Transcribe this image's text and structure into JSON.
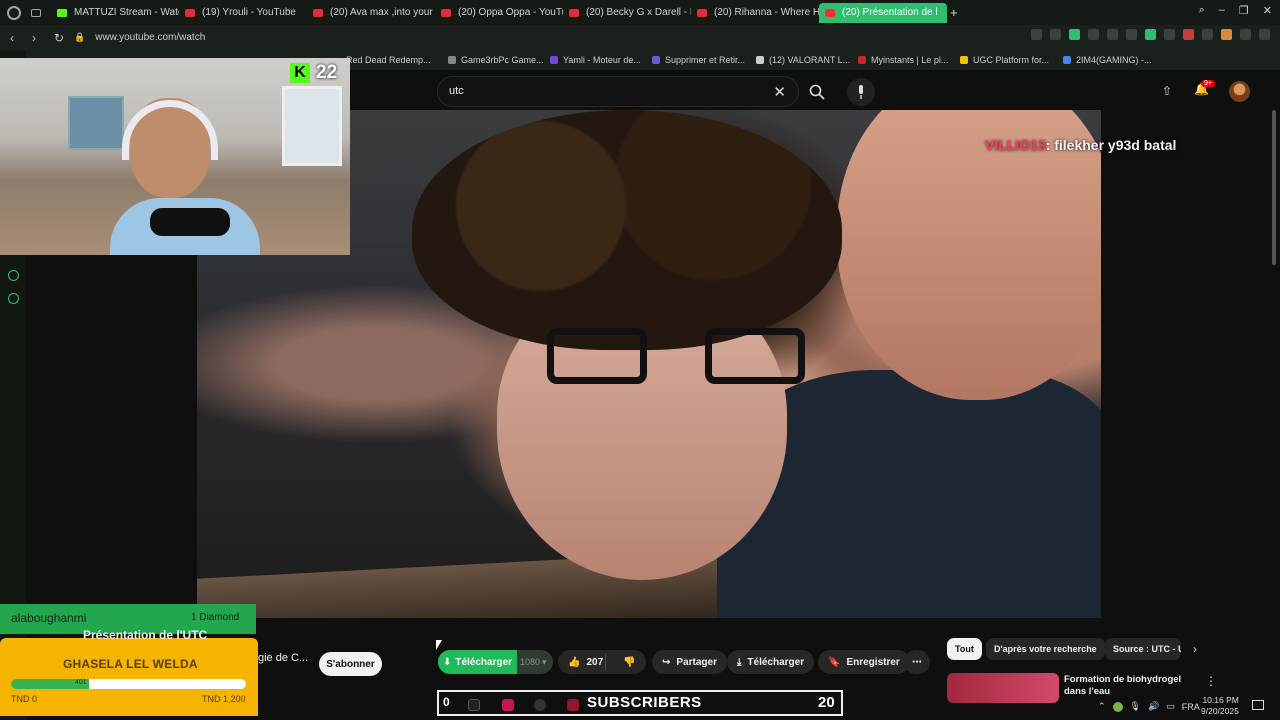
{
  "browser": {
    "tabs": [
      {
        "label": "MATTUZI Stream - Watch",
        "kind": "kick"
      },
      {
        "label": "(19) Yrouli - YouTube",
        "kind": "yt"
      },
      {
        "label": "(20) Ava max ,into your a",
        "kind": "yt"
      },
      {
        "label": "(20) Oppa Oppa - YouTu",
        "kind": "yt"
      },
      {
        "label": "(20) Becky G x Darell - M",
        "kind": "yt"
      },
      {
        "label": "(20) Rihanna - Where Ha",
        "kind": "yt"
      },
      {
        "label": "(20) Présentation de l",
        "kind": "yt",
        "active": true
      }
    ],
    "url": "www.youtube.com/watch",
    "bookmarks": [
      "Red Dead Redemp...",
      "Game3rbPc Game...",
      "Yamli - Moteur de...",
      "Supprimer et Retir...",
      "(12) VALORANT L...",
      "Myinstants | Le pl...",
      "UGC Platform for...",
      "2IM4(GAMING) -..."
    ]
  },
  "youtube": {
    "search_value": "utc",
    "notifications_badge": "9+",
    "video_title_partial": "Présentation de l'UTC",
    "channel_partial": "gie de C...",
    "subscribe_label": "S'abonner",
    "download_green_label": "Télécharger",
    "quality_label": "1080",
    "like_count": "207",
    "share_label": "Partager",
    "download_label": "Télécharger",
    "save_label": "Enregistrer",
    "chips": [
      "Tout",
      "D'après votre recherche",
      "Source : UTC - U"
    ],
    "recommendation_title": "Formation de biohydrogel dans l'eau"
  },
  "stream_overlay": {
    "kick_viewers": "22",
    "chat_user": "VILLIO13",
    "chat_text": ": filekher y93d batal",
    "donor_name": "alaboughanmi",
    "donor_amount": "1",
    "donor_unit": "Diamond",
    "goal_name": "GHASELA LEL WELDA",
    "goal_progress_label": "401",
    "goal_min": "TND 0",
    "goal_max": "TND 1,200",
    "goal_fraction": 0.334,
    "subs_left": "0",
    "subs_label": "SUBSCRIBERS",
    "subs_count": "20"
  },
  "taskbar": {
    "language": "FRA",
    "time": "10:16 PM",
    "date": "9/20/2025"
  },
  "colors": {
    "opera_green": "#2fbf71",
    "kick_green": "#53fc18",
    "goal_yellow": "#f4b400",
    "chat_user_red": "#ff3b5c"
  }
}
